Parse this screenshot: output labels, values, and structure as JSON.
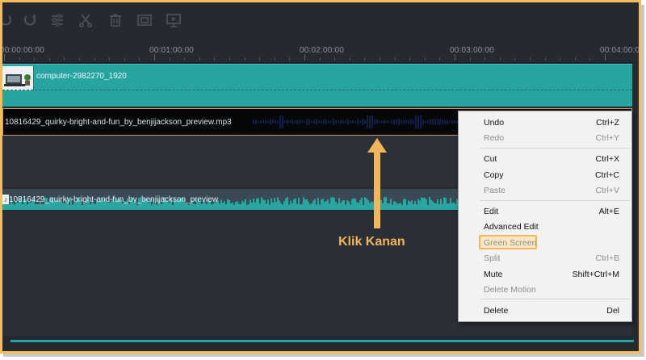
{
  "toolbar": {
    "icons": [
      "undo-icon",
      "redo-icon",
      "adjust-icon",
      "cut-icon",
      "delete-icon",
      "crop-icon",
      "snapshot-icon"
    ]
  },
  "ruler": {
    "timestamps": [
      "00:00:00:00",
      "00:01:00:00",
      "00:02:00:00",
      "00:03:00:00",
      "00:04:00:00"
    ]
  },
  "tracks": {
    "video_clip_label": "computer-2982270_1920",
    "audio_clip_label": "10816429_quirky-bright-and-fun_by_benjijackson_preview.mp3",
    "music_clip_label": "10816429_quirky-bright-and-fun_by_benjijackson_preview"
  },
  "annotation": {
    "label": "Klik Kanan",
    "color": "#f2b55a"
  },
  "context_menu": {
    "undo": {
      "label": "Undo",
      "shortcut": "Ctrl+Z"
    },
    "redo": {
      "label": "Redo",
      "shortcut": "Ctrl+Y"
    },
    "cut": {
      "label": "Cut",
      "shortcut": "Ctrl+X"
    },
    "copy": {
      "label": "Copy",
      "shortcut": "Ctrl+C"
    },
    "paste": {
      "label": "Paste",
      "shortcut": "Ctrl+V"
    },
    "edit": {
      "label": "Edit",
      "shortcut": "Alt+E"
    },
    "advanced_edit": {
      "label": "Advanced Edit",
      "shortcut": ""
    },
    "green_screen": {
      "label": "Green Screen",
      "shortcut": ""
    },
    "split": {
      "label": "Split",
      "shortcut": "Ctrl+B"
    },
    "mute": {
      "label": "Mute",
      "shortcut": "Shift+Ctrl+M"
    },
    "delete_motion": {
      "label": "Delete Motion",
      "shortcut": ""
    },
    "delete": {
      "label": "Delete",
      "shortcut": "Del"
    }
  },
  "colors": {
    "accent": "#27a3a0",
    "highlight": "#f2b55a",
    "timeline_bg": "#262a30"
  }
}
